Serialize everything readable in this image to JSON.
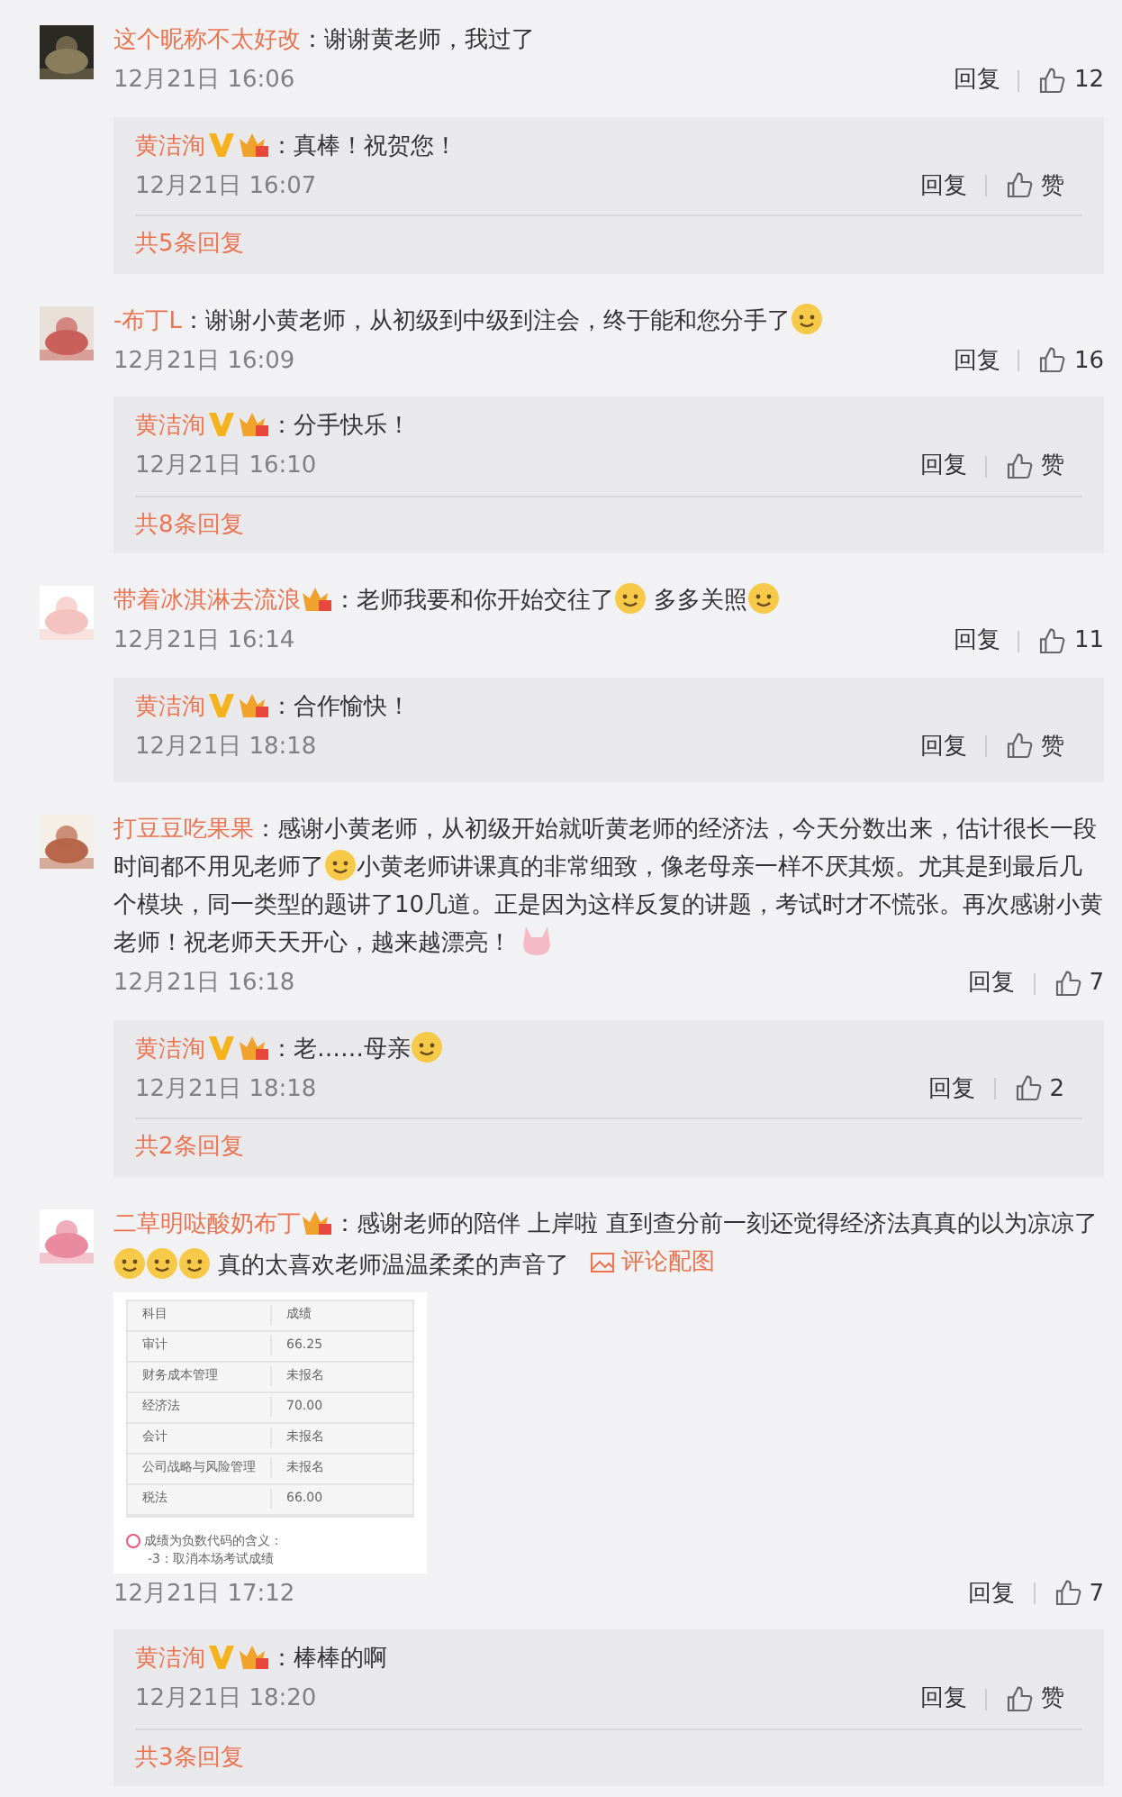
{
  "comments": [
    {
      "user": "这个昵称不太好改",
      "member_badge": false,
      "content": [
        {
          "kind": "text",
          "text": "：谢谢黄老师，我过了"
        }
      ],
      "time": "12月21日 16:06",
      "reply_label": "回复",
      "like": "12",
      "replies": [
        {
          "user": "黄洁洵",
          "verified": true,
          "member_badge": true,
          "content": [
            {
              "kind": "text",
              "text": "：真棒！祝贺您！"
            }
          ],
          "time": "12月21日 16:07",
          "reply_label": "回复",
          "like": "赞"
        }
      ],
      "more": "共5条回复"
    },
    {
      "user": "-布丁L",
      "member_badge": false,
      "content": [
        {
          "kind": "text",
          "text": "：谢谢小黄老师，从初级到中级到注会，终于能和您分手了"
        },
        {
          "kind": "emoji"
        }
      ],
      "time": "12月21日 16:09",
      "reply_label": "回复",
      "like": "16",
      "replies": [
        {
          "user": "黄洁洵",
          "verified": true,
          "member_badge": true,
          "content": [
            {
              "kind": "text",
              "text": "：分手快乐！"
            }
          ],
          "time": "12月21日 16:10",
          "reply_label": "回复",
          "like": "赞"
        }
      ],
      "more": "共8条回复"
    },
    {
      "user": "带着冰淇淋去流浪",
      "member_badge": true,
      "content": [
        {
          "kind": "text",
          "text": "：老师我要和你开始交往了"
        },
        {
          "kind": "emoji"
        },
        {
          "kind": "text",
          "text": " 多多关照"
        },
        {
          "kind": "emoji"
        }
      ],
      "time": "12月21日 16:14",
      "reply_label": "回复",
      "like": "11",
      "replies": [
        {
          "user": "黄洁洵",
          "verified": true,
          "member_badge": true,
          "content": [
            {
              "kind": "text",
              "text": "：合作愉快！"
            }
          ],
          "time": "12月21日 18:18",
          "reply_label": "回复",
          "like": "赞"
        }
      ]
    },
    {
      "user": "打豆豆吃果果",
      "member_badge": false,
      "content": [
        {
          "kind": "text",
          "text": "：感谢小黄老师，从初级开始就听黄老师的经济法，今天分数出来，估计很长一段时间都不用见老师了"
        },
        {
          "kind": "emoji"
        },
        {
          "kind": "text",
          "text": "小黄老师讲课真的非常细致，像老母亲一样不厌其烦。尤其是到最后几个模块，同一类型的题讲了10几道。正是因为这样反复的讲题，考试时才不慌张。再次感谢小黄老师！祝老师天天开心，越来越漂亮！ "
        },
        {
          "kind": "sticker"
        }
      ],
      "time": "12月21日 16:18",
      "reply_label": "回复",
      "like": "7",
      "replies": [
        {
          "user": "黄洁洵",
          "verified": true,
          "member_badge": true,
          "content": [
            {
              "kind": "text",
              "text": "：老……母亲"
            },
            {
              "kind": "emoji"
            }
          ],
          "time": "12月21日 18:18",
          "reply_label": "回复",
          "like": "2"
        }
      ],
      "more": "共2条回复"
    },
    {
      "user": "二草明哒酸奶布丁",
      "member_badge": true,
      "content": [
        {
          "kind": "text",
          "text": "：感谢老师的陪伴 上岸啦 直到查分前一刻还觉得经济法真真的以为凉凉了"
        },
        {
          "kind": "emoji"
        },
        {
          "kind": "emoji"
        },
        {
          "kind": "emoji"
        },
        {
          "kind": "text",
          "text": " 真的太喜欢老师温温柔柔的声音了"
        }
      ],
      "attachment_link": "评论配图",
      "attachment": {
        "rows": [
          [
            "科目",
            "成绩"
          ],
          [
            "审计",
            "66.25"
          ],
          [
            "财务成本管理",
            "未报名"
          ],
          [
            "经济法",
            "70.00"
          ],
          [
            "会计",
            "未报名"
          ],
          [
            "公司战略与风险管理",
            "未报名"
          ],
          [
            "税法",
            "66.00"
          ]
        ],
        "note": "成绩为负数代码的含义：",
        "note_line": "-3：取消本场考试成绩"
      },
      "time": "12月21日 17:12",
      "reply_label": "回复",
      "like": "7",
      "replies": [
        {
          "user": "黄洁洵",
          "verified": true,
          "member_badge": true,
          "content": [
            {
              "kind": "text",
              "text": "：棒棒的啊"
            }
          ],
          "time": "12月21日 18:20",
          "reply_label": "回复",
          "like": "赞"
        }
      ],
      "more": "共3条回复"
    }
  ]
}
